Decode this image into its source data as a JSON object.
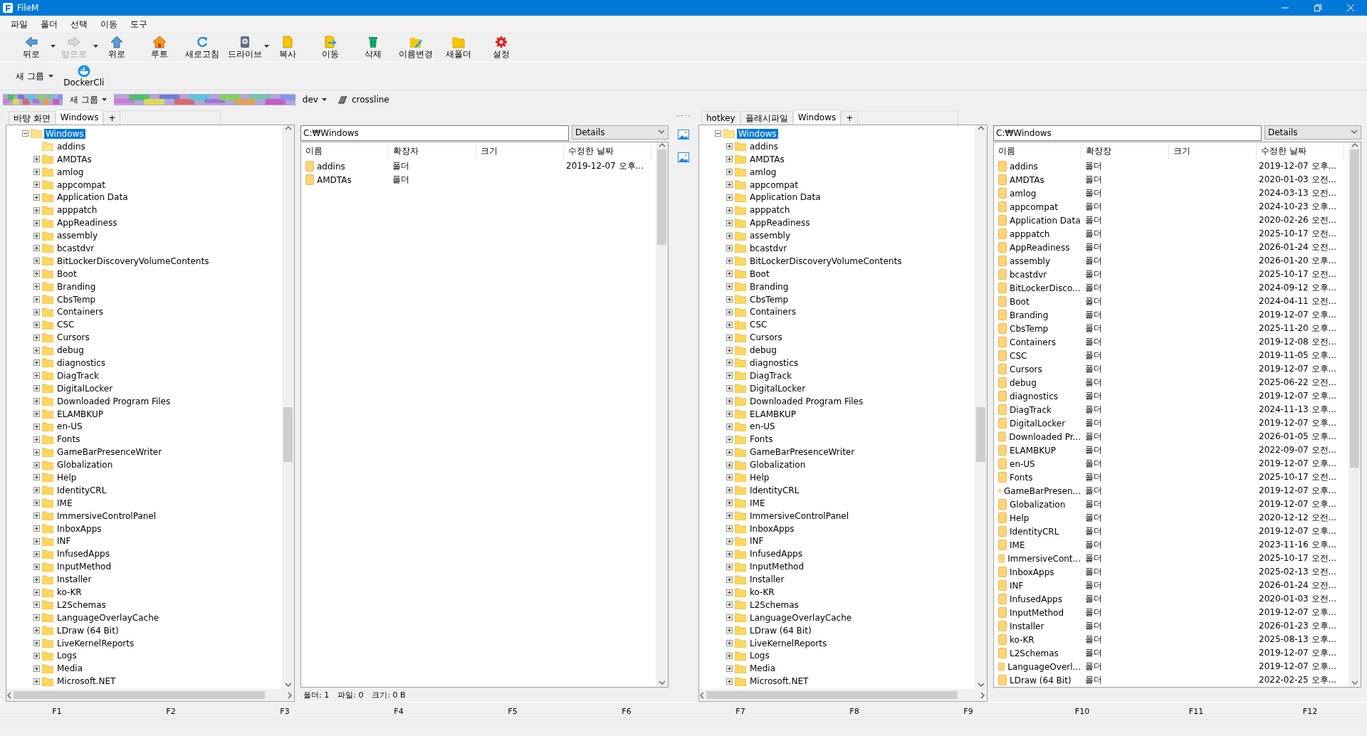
{
  "window": {
    "title": "FileM"
  },
  "menu": [
    "파일",
    "폴더",
    "선택",
    "이동",
    "도구"
  ],
  "toolbar": [
    {
      "label": "뒤로",
      "kind": "back",
      "dropdown": true,
      "disabled": false
    },
    {
      "label": "앞으로",
      "kind": "forward",
      "dropdown": true,
      "disabled": true
    },
    {
      "label": "위로",
      "kind": "up",
      "dropdown": false,
      "disabled": false
    },
    {
      "label": "루트",
      "kind": "home",
      "dropdown": false,
      "disabled": false
    },
    {
      "label": "새로고침",
      "kind": "refresh",
      "dropdown": false,
      "disabled": false
    },
    {
      "label": "드라이브",
      "kind": "drive",
      "dropdown": true,
      "disabled": false
    },
    {
      "label": "복사",
      "kind": "copy",
      "dropdown": false,
      "disabled": false
    },
    {
      "label": "이동",
      "kind": "move",
      "dropdown": false,
      "disabled": false
    },
    {
      "label": "삭제",
      "kind": "delete",
      "dropdown": false,
      "disabled": false
    },
    {
      "label": "이름변경",
      "kind": "rename",
      "dropdown": false,
      "disabled": false
    },
    {
      "label": "새폴더",
      "kind": "newfolder",
      "dropdown": false,
      "disabled": false
    },
    {
      "label": "설정",
      "kind": "settings",
      "dropdown": false,
      "disabled": false
    }
  ],
  "group_bar": {
    "group": "새 그룹",
    "items": [
      {
        "label": "DockerCli",
        "kind": "docker"
      }
    ]
  },
  "breadcrumb": [
    {
      "kind": "picture"
    },
    {
      "kind": "group",
      "label": "새 그룹"
    },
    {
      "kind": "picture"
    },
    {
      "kind": "dropdown",
      "label": "dev"
    },
    {
      "kind": "link",
      "label": "crossline"
    }
  ],
  "left_pane": {
    "tabs": [
      {
        "label": "바탕 화면",
        "selected": false
      },
      {
        "label": "Windows",
        "selected": true
      },
      {
        "label": "+",
        "selected": false
      }
    ],
    "tree": {
      "label": "Windows",
      "expanded": true,
      "selected": true,
      "children": [
        {
          "label": "addins",
          "expandable": false
        },
        {
          "label": "AMDTAs",
          "expandable": true
        },
        {
          "label": "amlog",
          "expandable": true
        },
        {
          "label": "appcompat",
          "expandable": true
        },
        {
          "label": "Application Data",
          "expandable": true
        },
        {
          "label": "apppatch",
          "expandable": true
        },
        {
          "label": "AppReadiness",
          "expandable": true
        },
        {
          "label": "assembly",
          "expandable": true
        },
        {
          "label": "bcastdvr",
          "expandable": true
        },
        {
          "label": "BitLockerDiscoveryVolumeContents",
          "expandable": true
        },
        {
          "label": "Boot",
          "expandable": true
        },
        {
          "label": "Branding",
          "expandable": true
        },
        {
          "label": "CbsTemp",
          "expandable": true
        },
        {
          "label": "Containers",
          "expandable": true
        },
        {
          "label": "CSC",
          "expandable": true
        },
        {
          "label": "Cursors",
          "expandable": true
        },
        {
          "label": "debug",
          "expandable": true
        },
        {
          "label": "diagnostics",
          "expandable": true
        },
        {
          "label": "DiagTrack",
          "expandable": true
        },
        {
          "label": "DigitalLocker",
          "expandable": true
        },
        {
          "label": "Downloaded Program Files",
          "expandable": true
        },
        {
          "label": "ELAMBKUP",
          "expandable": true
        },
        {
          "label": "en-US",
          "expandable": true
        },
        {
          "label": "Fonts",
          "expandable": true
        },
        {
          "label": "GameBarPresenceWriter",
          "expandable": true
        },
        {
          "label": "Globalization",
          "expandable": true
        },
        {
          "label": "Help",
          "expandable": true
        },
        {
          "label": "IdentityCRL",
          "expandable": true
        },
        {
          "label": "IME",
          "expandable": true
        },
        {
          "label": "ImmersiveControlPanel",
          "expandable": true
        },
        {
          "label": "InboxApps",
          "expandable": true
        },
        {
          "label": "INF",
          "expandable": true
        },
        {
          "label": "InfusedApps",
          "expandable": true
        },
        {
          "label": "InputMethod",
          "expandable": true
        },
        {
          "label": "Installer",
          "expandable": true
        },
        {
          "label": "ko-KR",
          "expandable": true
        },
        {
          "label": "L2Schemas",
          "expandable": true
        },
        {
          "label": "LanguageOverlayCache",
          "expandable": true
        },
        {
          "label": "LDraw (64 Bit)",
          "expandable": true
        },
        {
          "label": "LiveKernelReports",
          "expandable": true
        },
        {
          "label": "Logs",
          "expandable": true
        },
        {
          "label": "Media",
          "expandable": true
        },
        {
          "label": "Microsoft.NET",
          "expandable": true
        }
      ]
    },
    "list": {
      "path": "C:₩Windows",
      "view": "Details",
      "columns": [
        "이름",
        "확장자",
        "크기",
        "수정한 날짜"
      ],
      "rows": [
        {
          "name": "addins",
          "type": "폴더",
          "modified": "2019-12-07 오후..."
        },
        {
          "name": "AMDTAs",
          "type": "폴더"
        }
      ],
      "status": [
        "폴더: 1",
        "파일: 0",
        "크기: 0 B"
      ]
    }
  },
  "right_pane": {
    "tabs": [
      {
        "label": "hotkey",
        "selected": false
      },
      {
        "label": "플래시파일",
        "selected": false
      },
      {
        "label": "Windows",
        "selected": true
      },
      {
        "label": "+",
        "selected": false
      }
    ],
    "tree": {
      "label": "Windows",
      "expanded": true,
      "selected": true,
      "children": [
        {
          "label": "addins",
          "expandable": true
        },
        {
          "label": "AMDTAs",
          "expandable": true
        },
        {
          "label": "amlog",
          "expandable": true
        },
        {
          "label": "appcompat",
          "expandable": true
        },
        {
          "label": "Application Data",
          "expandable": true
        },
        {
          "label": "apppatch",
          "expandable": true
        },
        {
          "label": "AppReadiness",
          "expandable": true
        },
        {
          "label": "assembly",
          "expandable": true
        },
        {
          "label": "bcastdvr",
          "expandable": true
        },
        {
          "label": "BitLockerDiscoveryVolumeContents",
          "expandable": true
        },
        {
          "label": "Boot",
          "expandable": true
        },
        {
          "label": "Branding",
          "expandable": true
        },
        {
          "label": "CbsTemp",
          "expandable": true
        },
        {
          "label": "Containers",
          "expandable": true
        },
        {
          "label": "CSC",
          "expandable": true
        },
        {
          "label": "Cursors",
          "expandable": true
        },
        {
          "label": "debug",
          "expandable": true
        },
        {
          "label": "diagnostics",
          "expandable": true
        },
        {
          "label": "DiagTrack",
          "expandable": true
        },
        {
          "label": "DigitalLocker",
          "expandable": true
        },
        {
          "label": "Downloaded Program Files",
          "expandable": true
        },
        {
          "label": "ELAMBKUP",
          "expandable": true
        },
        {
          "label": "en-US",
          "expandable": true
        },
        {
          "label": "Fonts",
          "expandable": true
        },
        {
          "label": "GameBarPresenceWriter",
          "expandable": true
        },
        {
          "label": "Globalization",
          "expandable": true
        },
        {
          "label": "Help",
          "expandable": true
        },
        {
          "label": "IdentityCRL",
          "expandable": true
        },
        {
          "label": "IME",
          "expandable": true
        },
        {
          "label": "ImmersiveControlPanel",
          "expandable": true
        },
        {
          "label": "InboxApps",
          "expandable": true
        },
        {
          "label": "INF",
          "expandable": true
        },
        {
          "label": "InfusedApps",
          "expandable": true
        },
        {
          "label": "InputMethod",
          "expandable": true
        },
        {
          "label": "Installer",
          "expandable": true
        },
        {
          "label": "ko-KR",
          "expandable": true
        },
        {
          "label": "L2Schemas",
          "expandable": true
        },
        {
          "label": "LanguageOverlayCache",
          "expandable": true
        },
        {
          "label": "LDraw (64 Bit)",
          "expandable": true
        },
        {
          "label": "LiveKernelReports",
          "expandable": true
        },
        {
          "label": "Logs",
          "expandable": true
        },
        {
          "label": "Media",
          "expandable": true
        },
        {
          "label": "Microsoft.NET",
          "expandable": true
        }
      ]
    },
    "list": {
      "path": "C:₩Windows",
      "view": "Details",
      "columns": [
        "이름",
        "확장장",
        "크기",
        "수정한 날짜"
      ],
      "rows": [
        {
          "name": "addins",
          "type": "폴더",
          "modified": "2019-12-07 오후..."
        },
        {
          "name": "AMDTAs",
          "type": "폴더",
          "modified": "2020-01-03 오전..."
        },
        {
          "name": "amlog",
          "type": "폴더",
          "modified": "2024-03-13 오전..."
        },
        {
          "name": "appcompat",
          "type": "폴더",
          "modified": "2024-10-23 오후..."
        },
        {
          "name": "Application Data",
          "type": "폴더",
          "modified": "2020-02-26 오전..."
        },
        {
          "name": "apppatch",
          "type": "폴더",
          "modified": "2025-10-17 오전..."
        },
        {
          "name": "AppReadiness",
          "type": "폴더",
          "modified": "2026-01-24 오전..."
        },
        {
          "name": "assembly",
          "type": "폴더",
          "modified": "2026-01-20 오후..."
        },
        {
          "name": "bcastdvr",
          "type": "폴더",
          "modified": "2025-10-17 오전..."
        },
        {
          "name": "BitLockerDisco...",
          "type": "폴더",
          "modified": "2024-09-12 오후..."
        },
        {
          "name": "Boot",
          "type": "폴더",
          "modified": "2024-04-11 오전..."
        },
        {
          "name": "Branding",
          "type": "폴더",
          "modified": "2019-12-07 오후..."
        },
        {
          "name": "CbsTemp",
          "type": "폴더",
          "modified": "2025-11-20 오후..."
        },
        {
          "name": "Containers",
          "type": "폴더",
          "modified": "2019-12-08 오전..."
        },
        {
          "name": "CSC",
          "type": "폴더",
          "modified": "2019-11-05 오후..."
        },
        {
          "name": "Cursors",
          "type": "폴더",
          "modified": "2019-12-07 오후..."
        },
        {
          "name": "debug",
          "type": "폴더",
          "modified": "2025-06-22 오전..."
        },
        {
          "name": "diagnostics",
          "type": "폴더",
          "modified": "2019-12-07 오후..."
        },
        {
          "name": "DiagTrack",
          "type": "폴더",
          "modified": "2024-11-13 오후..."
        },
        {
          "name": "DigitalLocker",
          "type": "폴더",
          "modified": "2019-12-07 오후..."
        },
        {
          "name": "Downloaded Pr...",
          "type": "폴더",
          "modified": "2026-01-05 오후..."
        },
        {
          "name": "ELAMBKUP",
          "type": "폴더",
          "modified": "2022-09-07 오전..."
        },
        {
          "name": "en-US",
          "type": "폴더",
          "modified": "2019-12-07 오후..."
        },
        {
          "name": "Fonts",
          "type": "폴더",
          "modified": "2025-10-17 오전..."
        },
        {
          "name": "GameBarPresen...",
          "type": "폴더",
          "modified": "2019-12-07 오후..."
        },
        {
          "name": "Globalization",
          "type": "폴더",
          "modified": "2019-12-07 오후..."
        },
        {
          "name": "Help",
          "type": "폴더",
          "modified": "2020-12-12 오전..."
        },
        {
          "name": "IdentityCRL",
          "type": "폴더",
          "modified": "2019-12-07 오후..."
        },
        {
          "name": "IME",
          "type": "폴더",
          "modified": "2023-11-16 오후..."
        },
        {
          "name": "ImmersiveCont...",
          "type": "폴더",
          "modified": "2025-10-17 오전..."
        },
        {
          "name": "InboxApps",
          "type": "폴더",
          "modified": "2025-02-13 오전..."
        },
        {
          "name": "INF",
          "type": "폴더",
          "modified": "2026-01-24 오전..."
        },
        {
          "name": "InfusedApps",
          "type": "폴더",
          "modified": "2020-01-03 오전..."
        },
        {
          "name": "InputMethod",
          "type": "폴더",
          "modified": "2019-12-07 오후..."
        },
        {
          "name": "Installer",
          "type": "폴더",
          "modified": "2026-01-23 오후..."
        },
        {
          "name": "ko-KR",
          "type": "폴더",
          "modified": "2025-08-13 오후..."
        },
        {
          "name": "L2Schemas",
          "type": "폴더",
          "modified": "2019-12-07 오후..."
        },
        {
          "name": "LanguageOverl...",
          "type": "폴더",
          "modified": "2019-12-07 오후..."
        },
        {
          "name": "LDraw (64 Bit)",
          "type": "폴더",
          "modified": "2022-02-25 오후..."
        }
      ]
    }
  },
  "function_keys": [
    "F1",
    "F2",
    "F3",
    "F4",
    "F5",
    "F6",
    "F7",
    "F8",
    "F9",
    "F10",
    "F11",
    "F12"
  ]
}
